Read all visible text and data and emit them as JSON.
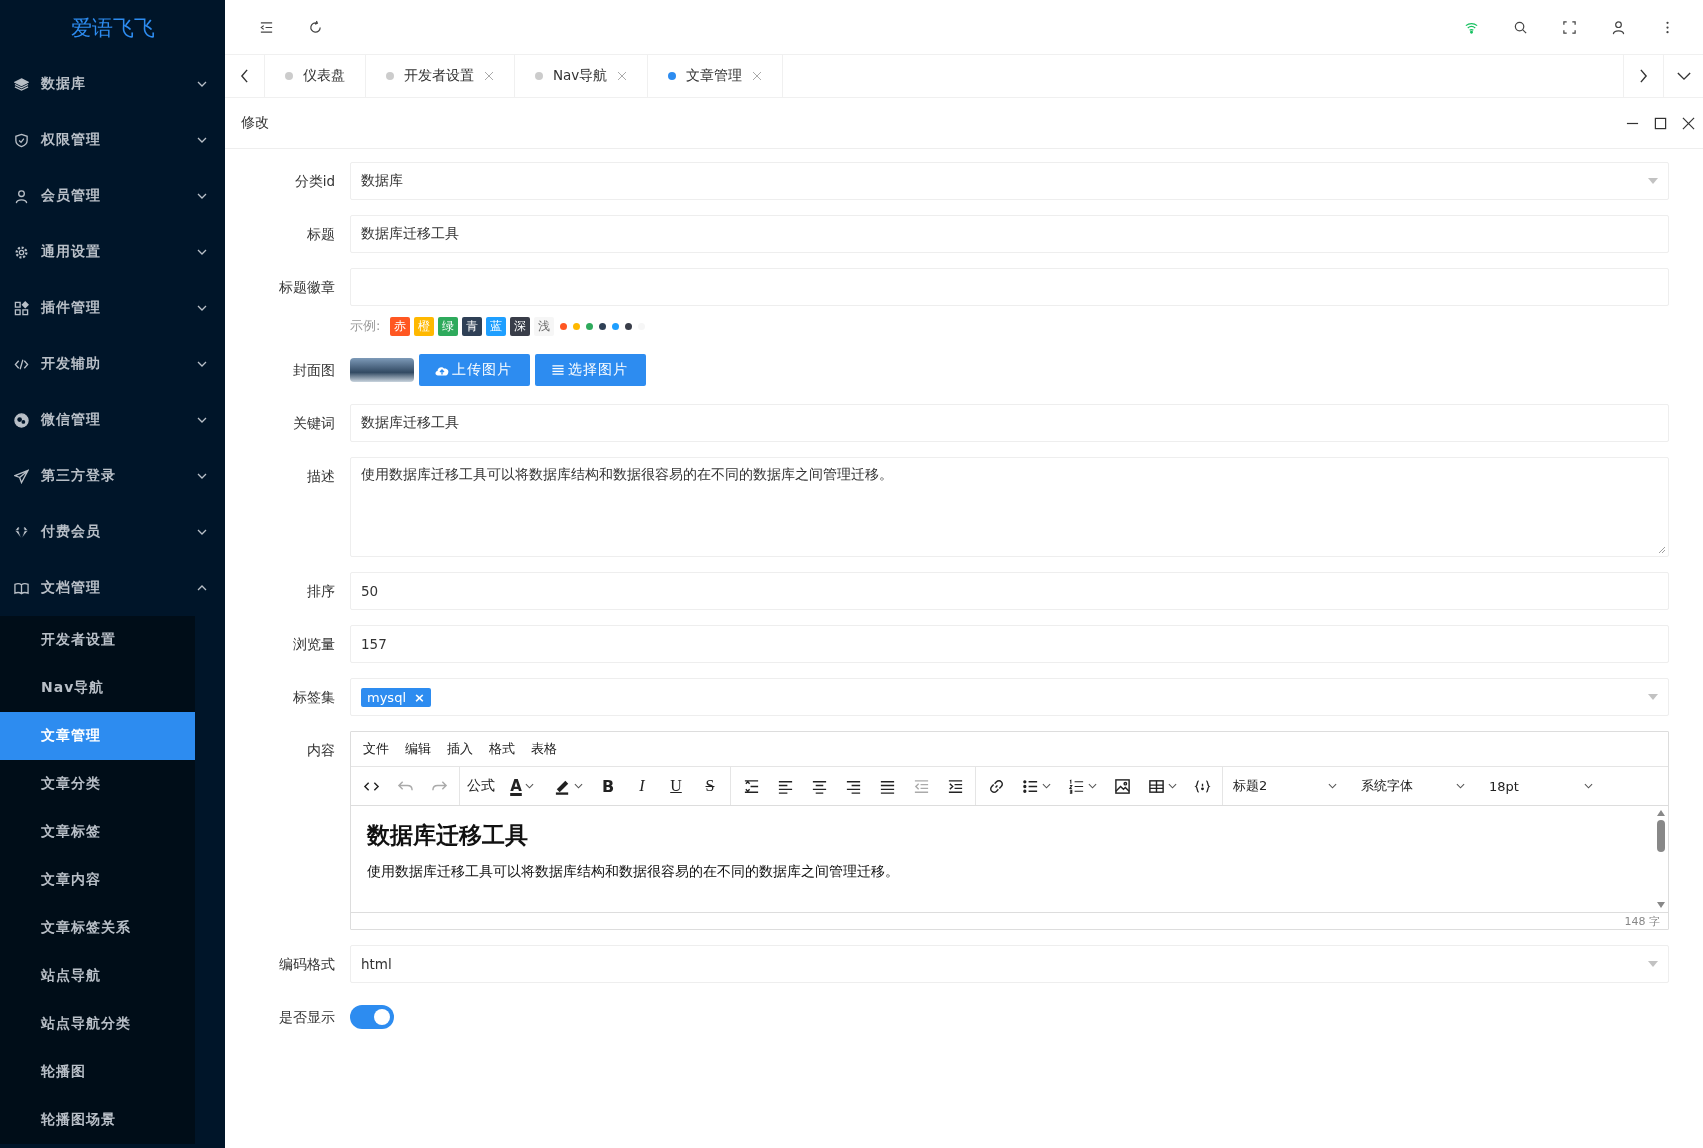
{
  "logo": "爱语飞飞",
  "sidebar": {
    "items": [
      {
        "label": "数据库",
        "kind": "layers",
        "expanded": false
      },
      {
        "label": "权限管理",
        "kind": "shield",
        "expanded": false
      },
      {
        "label": "会员管理",
        "kind": "user",
        "expanded": false
      },
      {
        "label": "通用设置",
        "kind": "gear",
        "expanded": false
      },
      {
        "label": "插件管理",
        "kind": "apps",
        "expanded": false
      },
      {
        "label": "开发辅助",
        "kind": "code",
        "expanded": false
      },
      {
        "label": "微信管理",
        "kind": "chat",
        "expanded": false
      },
      {
        "label": "第三方登录",
        "kind": "send",
        "expanded": false
      },
      {
        "label": "付费会员",
        "kind": "diamond",
        "expanded": false
      },
      {
        "label": "文档管理",
        "kind": "book",
        "expanded": true,
        "children": [
          {
            "label": "开发者设置",
            "selected": false
          },
          {
            "label": "Nav导航",
            "selected": false
          },
          {
            "label": "文章管理",
            "selected": true
          },
          {
            "label": "文章分类",
            "selected": false
          },
          {
            "label": "文章标签",
            "selected": false
          },
          {
            "label": "文章内容",
            "selected": false
          },
          {
            "label": "文章标签关系",
            "selected": false
          },
          {
            "label": "站点导航",
            "selected": false
          },
          {
            "label": "站点导航分类",
            "selected": false
          },
          {
            "label": "轮播图",
            "selected": false
          },
          {
            "label": "轮播图场景",
            "selected": false
          }
        ]
      }
    ]
  },
  "tabs": [
    {
      "label": "仪表盘",
      "selected": false,
      "closable": false
    },
    {
      "label": "开发者设置",
      "selected": false,
      "closable": true
    },
    {
      "label": "Nav导航",
      "selected": false,
      "closable": true
    },
    {
      "label": "文章管理",
      "selected": true,
      "closable": true
    }
  ],
  "panel": {
    "title": "修改"
  },
  "form": {
    "rows": [
      {
        "kind": "select",
        "label": "分类id",
        "value": "数据库"
      },
      {
        "kind": "text",
        "label": "标题",
        "value": "数据库迁移工具"
      },
      {
        "kind": "badge",
        "label": "标题徽章",
        "example_label": "示例:",
        "tags": [
          {
            "text": "赤",
            "color": "#ff5722"
          },
          {
            "text": "橙",
            "color": "#ffb800"
          },
          {
            "text": "绿",
            "color": "#2eaa5c"
          },
          {
            "text": "青",
            "color": "#2f4056"
          },
          {
            "text": "蓝",
            "color": "#1e9fff"
          },
          {
            "text": "深",
            "color": "#393d49"
          },
          {
            "text": "浅",
            "color": "#f6f6f6"
          }
        ],
        "dots": [
          {
            "color": "#ff5722"
          },
          {
            "color": "#ffb800"
          },
          {
            "color": "#2eaa5c"
          },
          {
            "color": "#2f4056"
          },
          {
            "color": "#1e9fff"
          },
          {
            "color": "#393d49"
          },
          {
            "color": "#f6f6f6"
          }
        ]
      },
      {
        "kind": "image",
        "label": "封面图",
        "upload": "上传图片",
        "choose": "选择图片"
      },
      {
        "kind": "text",
        "label": "关键词",
        "value": "数据库迁移工具"
      },
      {
        "kind": "textarea",
        "label": "描述",
        "value": "使用数据库迁移工具可以将数据库结构和数据很容易的在不同的数据库之间管理迁移。"
      },
      {
        "kind": "text",
        "label": "排序",
        "value": "50"
      },
      {
        "kind": "text",
        "label": "浏览量",
        "value": "157"
      },
      {
        "kind": "tags",
        "label": "标签集",
        "tags": [
          "mysql"
        ],
        "remove": "×"
      },
      {
        "kind": "editor",
        "label": "内容",
        "menu": [
          "文件",
          "编辑",
          "插入",
          "格式",
          "表格"
        ],
        "toolbar_groups": [
          [
            {
              "kind": "code",
              "disabled": false
            },
            {
              "kind": "undo",
              "disabled": true
            },
            {
              "kind": "redo",
              "disabled": true
            }
          ],
          [
            {
              "kind": "text",
              "label": "公式",
              "disabled": false
            },
            {
              "kind": "fontcolor",
              "label": "A",
              "disabled": false
            },
            {
              "kind": "highlight",
              "disabled": false
            },
            {
              "kind": "bold",
              "label": "B",
              "disabled": false
            },
            {
              "kind": "italic",
              "label": "I",
              "disabled": false
            },
            {
              "kind": "underline",
              "label": "U",
              "disabled": false
            },
            {
              "kind": "strike",
              "label": "S",
              "disabled": false
            }
          ],
          [
            {
              "kind": "lineheight",
              "disabled": false
            },
            {
              "kind": "alignleft",
              "disabled": false
            },
            {
              "kind": "aligncenter",
              "disabled": false
            },
            {
              "kind": "alignright",
              "disabled": false
            },
            {
              "kind": "justify",
              "disabled": false
            },
            {
              "kind": "outdent",
              "disabled": true
            },
            {
              "kind": "indent",
              "disabled": false
            }
          ],
          [
            {
              "kind": "link",
              "disabled": false
            },
            {
              "kind": "bullist",
              "disabled": false
            },
            {
              "kind": "numlist",
              "disabled": false
            },
            {
              "kind": "image",
              "disabled": false
            },
            {
              "kind": "table",
              "disabled": false
            },
            {
              "kind": "codesample",
              "disabled": false
            }
          ]
        ],
        "selects": [
          "标题2",
          "系统字体",
          "18pt"
        ],
        "heading": "数据库迁移工具",
        "paragraph": "使用数据库迁移工具可以将数据库结构和数据很容易的在不同的数据库之间管理迁移。",
        "word_count": "148 字"
      },
      {
        "kind": "select",
        "label": "编码格式",
        "value": "html"
      },
      {
        "kind": "switch",
        "label": "是否显示",
        "on": true
      }
    ]
  }
}
